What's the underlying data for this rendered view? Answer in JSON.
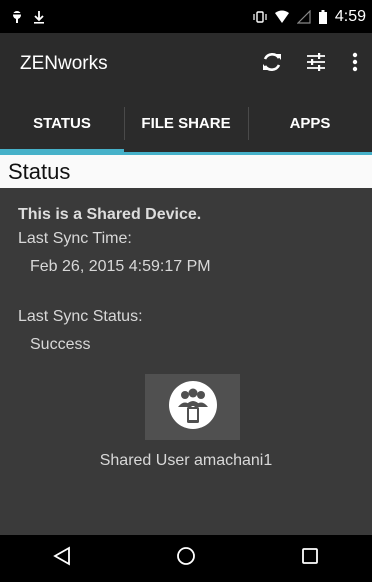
{
  "status_bar": {
    "time": "4:59",
    "icons": [
      "notification-icon",
      "download-icon",
      "vibrate-icon",
      "wifi-icon",
      "signal-icon",
      "battery-icon"
    ]
  },
  "app_bar": {
    "title": "ZENworks",
    "actions": [
      "sync-icon",
      "settings-sliders-icon",
      "overflow-menu-icon"
    ]
  },
  "tabs": [
    {
      "label": "STATUS",
      "active": true
    },
    {
      "label": "FILE SHARE",
      "active": false
    },
    {
      "label": "APPS",
      "active": false
    }
  ],
  "section": {
    "title": "Status"
  },
  "status": {
    "shared_notice": "This is a Shared Device.",
    "last_sync_time_label": "Last Sync Time:",
    "last_sync_time_value": "Feb 26, 2015 4:59:17 PM",
    "last_sync_status_label": "Last Sync Status:",
    "last_sync_status_value": "Success"
  },
  "shared_user": {
    "caption": "Shared User amachani1"
  },
  "colors": {
    "accent": "#46b1c9",
    "background": "#3a3a3a",
    "app_bar": "#2b2b2b"
  },
  "nav_bar": {
    "buttons": [
      "back-icon",
      "home-icon",
      "recents-icon"
    ]
  }
}
